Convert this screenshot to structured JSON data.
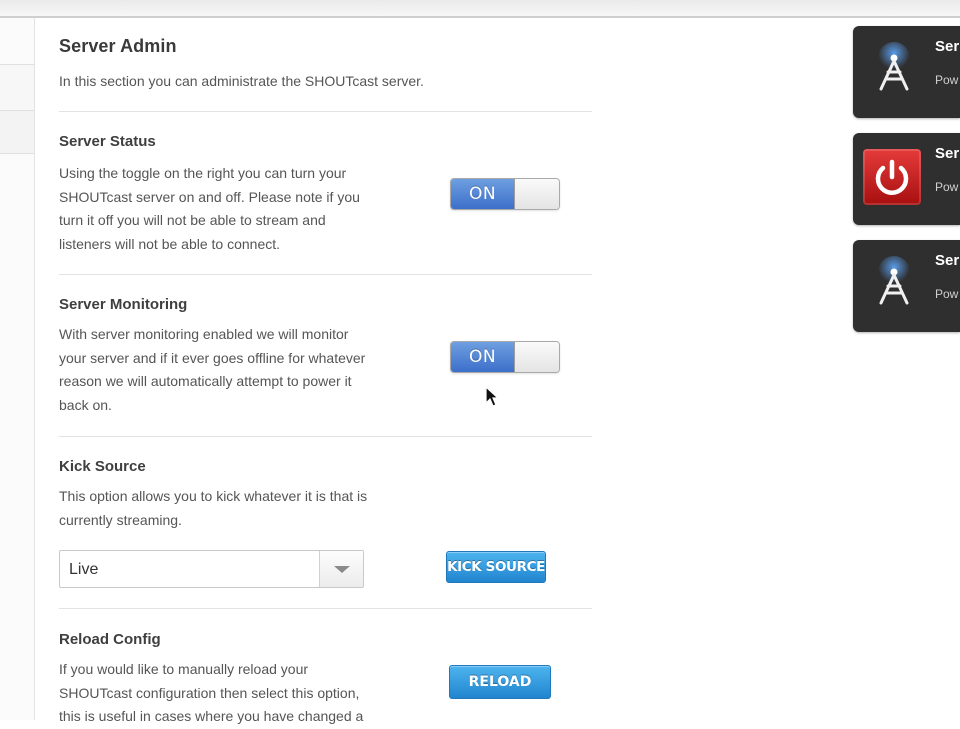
{
  "page": {
    "title": "Server Admin",
    "description": "In this section you can administrate the SHOUTcast server."
  },
  "sections": {
    "server_status": {
      "title": "Server Status",
      "lines": [
        "Using the toggle on the right you can turn your",
        "SHOUTcast server on and off. Please note if you",
        "turn it off you will not be able to stream and",
        "listeners will not be able to connect."
      ],
      "toggle_label": "ON"
    },
    "server_monitoring": {
      "title": "Server Monitoring",
      "lines": [
        "With server monitoring enabled we will monitor",
        "your server and if it ever goes offline for whatever",
        "reason we will automatically attempt to power it",
        "back on."
      ],
      "toggle_label": "ON"
    },
    "kick_source": {
      "title": "Kick Source",
      "lines": [
        "This option allows you to kick whatever it is that is",
        "currently streaming."
      ],
      "select_value": "Live",
      "button_label": "KICK SOURCE"
    },
    "reload_config": {
      "title": "Reload Config",
      "lines": [
        "If you would like to manually reload your",
        "SHOUTcast configuration then select this option,",
        "this is useful in cases where you have changed a"
      ],
      "button_label": "RELOAD"
    }
  },
  "side_cards": [
    {
      "name": "Ser",
      "sub": "Pow",
      "icon": "antenna-icon"
    },
    {
      "name": "Ser",
      "sub": "Pow",
      "icon": "power-icon"
    },
    {
      "name": "Ser",
      "sub": "Pow",
      "icon": "antenna-icon"
    }
  ],
  "colors": {
    "toggle_on": "#3c6fca",
    "button_blue": "#2185cf",
    "card_bg": "#2f2f2f",
    "power_red": "#c81d1d"
  }
}
